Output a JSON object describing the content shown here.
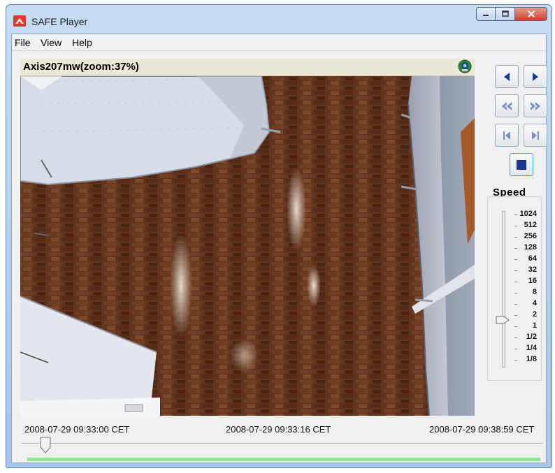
{
  "window": {
    "title": "SAFE Player"
  },
  "menu": [
    "File",
    "View",
    "Help"
  ],
  "camera": {
    "title": "Axis207mw(zoom:37%)",
    "status_icon": "camera-globe-icon"
  },
  "controls": {
    "step_back_icon": "triangle-left-icon",
    "step_forward_icon": "triangle-right-icon",
    "rewind_icon": "double-chevron-left-icon",
    "fast_forward_icon": "double-chevron-right-icon",
    "skip_start_icon": "skip-to-start-icon",
    "skip_end_icon": "skip-to-end-icon",
    "stop_icon": "stop-square-icon"
  },
  "speed": {
    "label": "Speed",
    "ticks": [
      "1024",
      "512",
      "256",
      "128",
      "64",
      "32",
      "16",
      "8",
      "4",
      "2",
      "1",
      "1/2",
      "1/4",
      "1/8"
    ],
    "selected": "1"
  },
  "timeline": {
    "start": "2008-07-29 09:33:00 CET",
    "current": "2008-07-29 09:33:16 CET",
    "end": "2008-07-29 09:38:59 CET",
    "position": 0.046
  },
  "colors": {
    "accent": "#17368f",
    "progress": "#8fe58f"
  }
}
